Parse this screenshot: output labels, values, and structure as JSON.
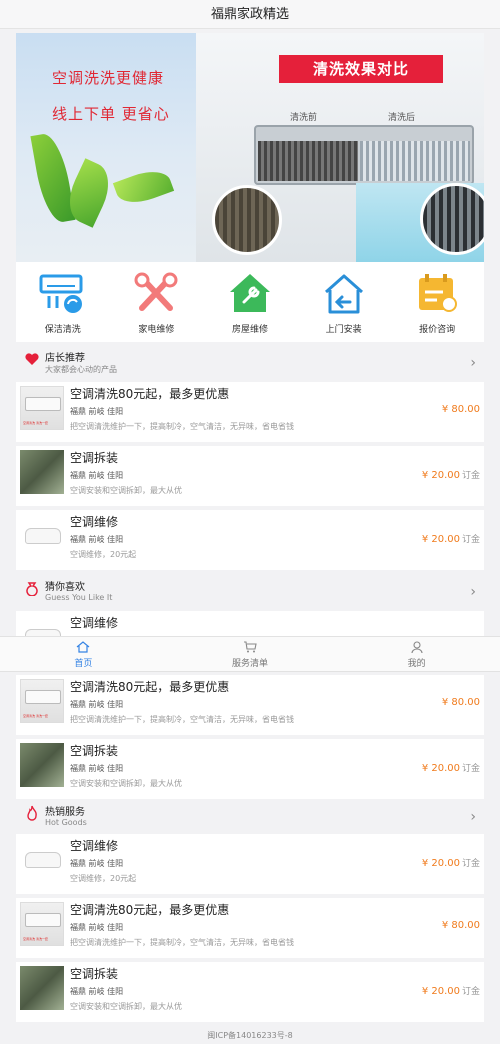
{
  "header": {
    "title": "福鼎家政精选"
  },
  "banner": {
    "line1": "空调洗洗更健康",
    "line2": "线上下单 更省心",
    "tag": "清洗效果对比",
    "before": "清洗前",
    "after": "清洗后"
  },
  "categories": [
    {
      "label": "保洁清洗",
      "icon": "ac-cleaning-icon"
    },
    {
      "label": "家电维修",
      "icon": "repair-tools-icon"
    },
    {
      "label": "房屋维修",
      "icon": "house-repair-icon"
    },
    {
      "label": "上门安装",
      "icon": "home-install-icon"
    },
    {
      "label": "报价咨询",
      "icon": "calendar-quote-icon"
    }
  ],
  "sections": {
    "recommend": {
      "title": "店长推荐",
      "subtitle": "大家都会心动的产品"
    },
    "guess": {
      "title": "猜你喜欢",
      "subtitle": "Guess You Like It"
    },
    "hot": {
      "title": "热销服务",
      "subtitle": "Hot Goods"
    }
  },
  "items": [
    {
      "title": "空调清洗80元起，最多更优惠",
      "loc": "福鼎 前岐 佳阳",
      "desc": "把空调清洗维护一下，提高制冷，空气清洁，无异味，省电省钱",
      "price": "¥ 80.00",
      "unit": "",
      "thumb_text": "空调清洗 清洗一套"
    },
    {
      "title": "空调拆装",
      "loc": "福鼎 前岐 佳阳",
      "desc": "空调安装和空调拆卸，最大从优",
      "price": "¥ 20.00",
      "unit": "订金"
    },
    {
      "title": "空调维修",
      "loc": "福鼎 前岐 佳阳",
      "desc": "空调维修，20元起",
      "price": "¥ 20.00",
      "unit": "订金"
    }
  ],
  "partial_item": {
    "title": "空调维修"
  },
  "tabbar": [
    {
      "label": "首页",
      "icon": "home-icon"
    },
    {
      "label": "服务清单",
      "icon": "cart-icon"
    },
    {
      "label": "我的",
      "icon": "user-icon"
    }
  ],
  "footer": {
    "icp": "闽ICP备14016233号-8"
  },
  "colors": {
    "accent": "#3483e4",
    "price": "#f07b1d",
    "tag": "#e5203a"
  }
}
